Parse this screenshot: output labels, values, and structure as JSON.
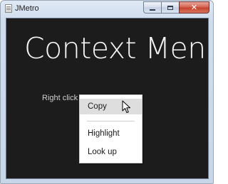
{
  "window": {
    "title": "JMetro",
    "app_icon": "window-app-icon",
    "caption_buttons": {
      "minimize_icon": "minimize-icon",
      "maximize_icon": "maximize-icon",
      "close_icon": "close-icon",
      "close_glyph": "✕"
    }
  },
  "content": {
    "background_color": "#1c1c1c",
    "headline": "Context Menu",
    "hint_text": "Right click"
  },
  "context_menu": {
    "items": [
      {
        "label": "Copy",
        "hovered": true
      },
      {
        "label": "Highlight",
        "hovered": false
      },
      {
        "label": "Look up",
        "hovered": false
      }
    ],
    "hover_color": "#dedede"
  },
  "cursor": {
    "icon": "mouse-pointer-icon"
  }
}
